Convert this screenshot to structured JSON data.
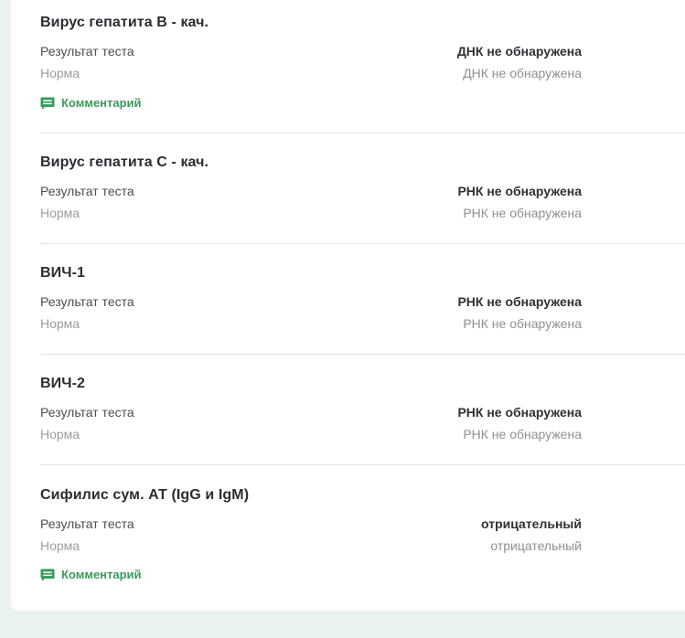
{
  "tests": [
    {
      "name": "Вирус гепатита В - кач.",
      "result_label": "Результат теста",
      "result_value": "ДНК не обнаружена",
      "norm_label": "Норма",
      "norm_value": "ДНК не обнаружена",
      "comment_label": "Комментарий"
    },
    {
      "name": "Вирус гепатита С - кач.",
      "result_label": "Результат теста",
      "result_value": "РНК не обнаружена",
      "norm_label": "Норма",
      "norm_value": "РНК не обнаружена"
    },
    {
      "name": "ВИЧ-1",
      "result_label": "Результат теста",
      "result_value": "РНК не обнаружена",
      "norm_label": "Норма",
      "norm_value": "РНК не обнаружена"
    },
    {
      "name": "ВИЧ-2",
      "result_label": "Результат теста",
      "result_value": "РНК не обнаружена",
      "norm_label": "Норма",
      "norm_value": "РНК не обнаружена"
    },
    {
      "name": "Сифилис сум. АТ (IgG и IgM)",
      "result_label": "Результат теста",
      "result_value": "отрицательный",
      "norm_label": "Норма",
      "norm_value": "отрицательный",
      "comment_label": "Комментарий"
    }
  ],
  "icons": {
    "comment": "comment-icon"
  },
  "colors": {
    "accent": "#3a9a5b",
    "page_background": "#eaf3ee",
    "card_background": "#ffffff"
  }
}
